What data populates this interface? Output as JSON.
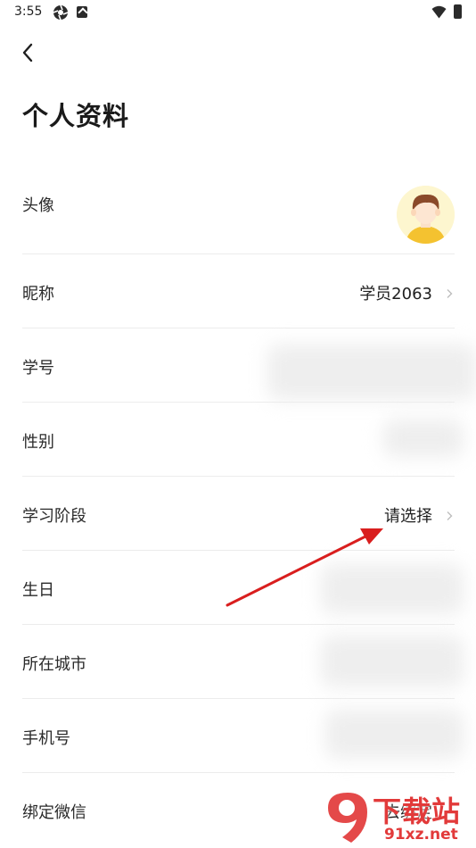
{
  "status_bar": {
    "time": "3:55"
  },
  "header": {
    "title": "个人资料"
  },
  "profile_rows": [
    {
      "label": "头像"
    },
    {
      "label": "昵称",
      "value": "学员2063"
    },
    {
      "label": "学号"
    },
    {
      "label": "性别"
    },
    {
      "label": "学习阶段",
      "value": "请选择"
    },
    {
      "label": "生日"
    },
    {
      "label": "所在城市"
    },
    {
      "label": "手机号"
    },
    {
      "label": "绑定微信",
      "value": "去绑定"
    }
  ],
  "watermark": {
    "brand": "下载站",
    "site": "91xz.net"
  },
  "colors": {
    "annotation_arrow": "#d91e1e",
    "watermark": "#e23a3a",
    "avatar_bg": "#fdf6cf"
  }
}
